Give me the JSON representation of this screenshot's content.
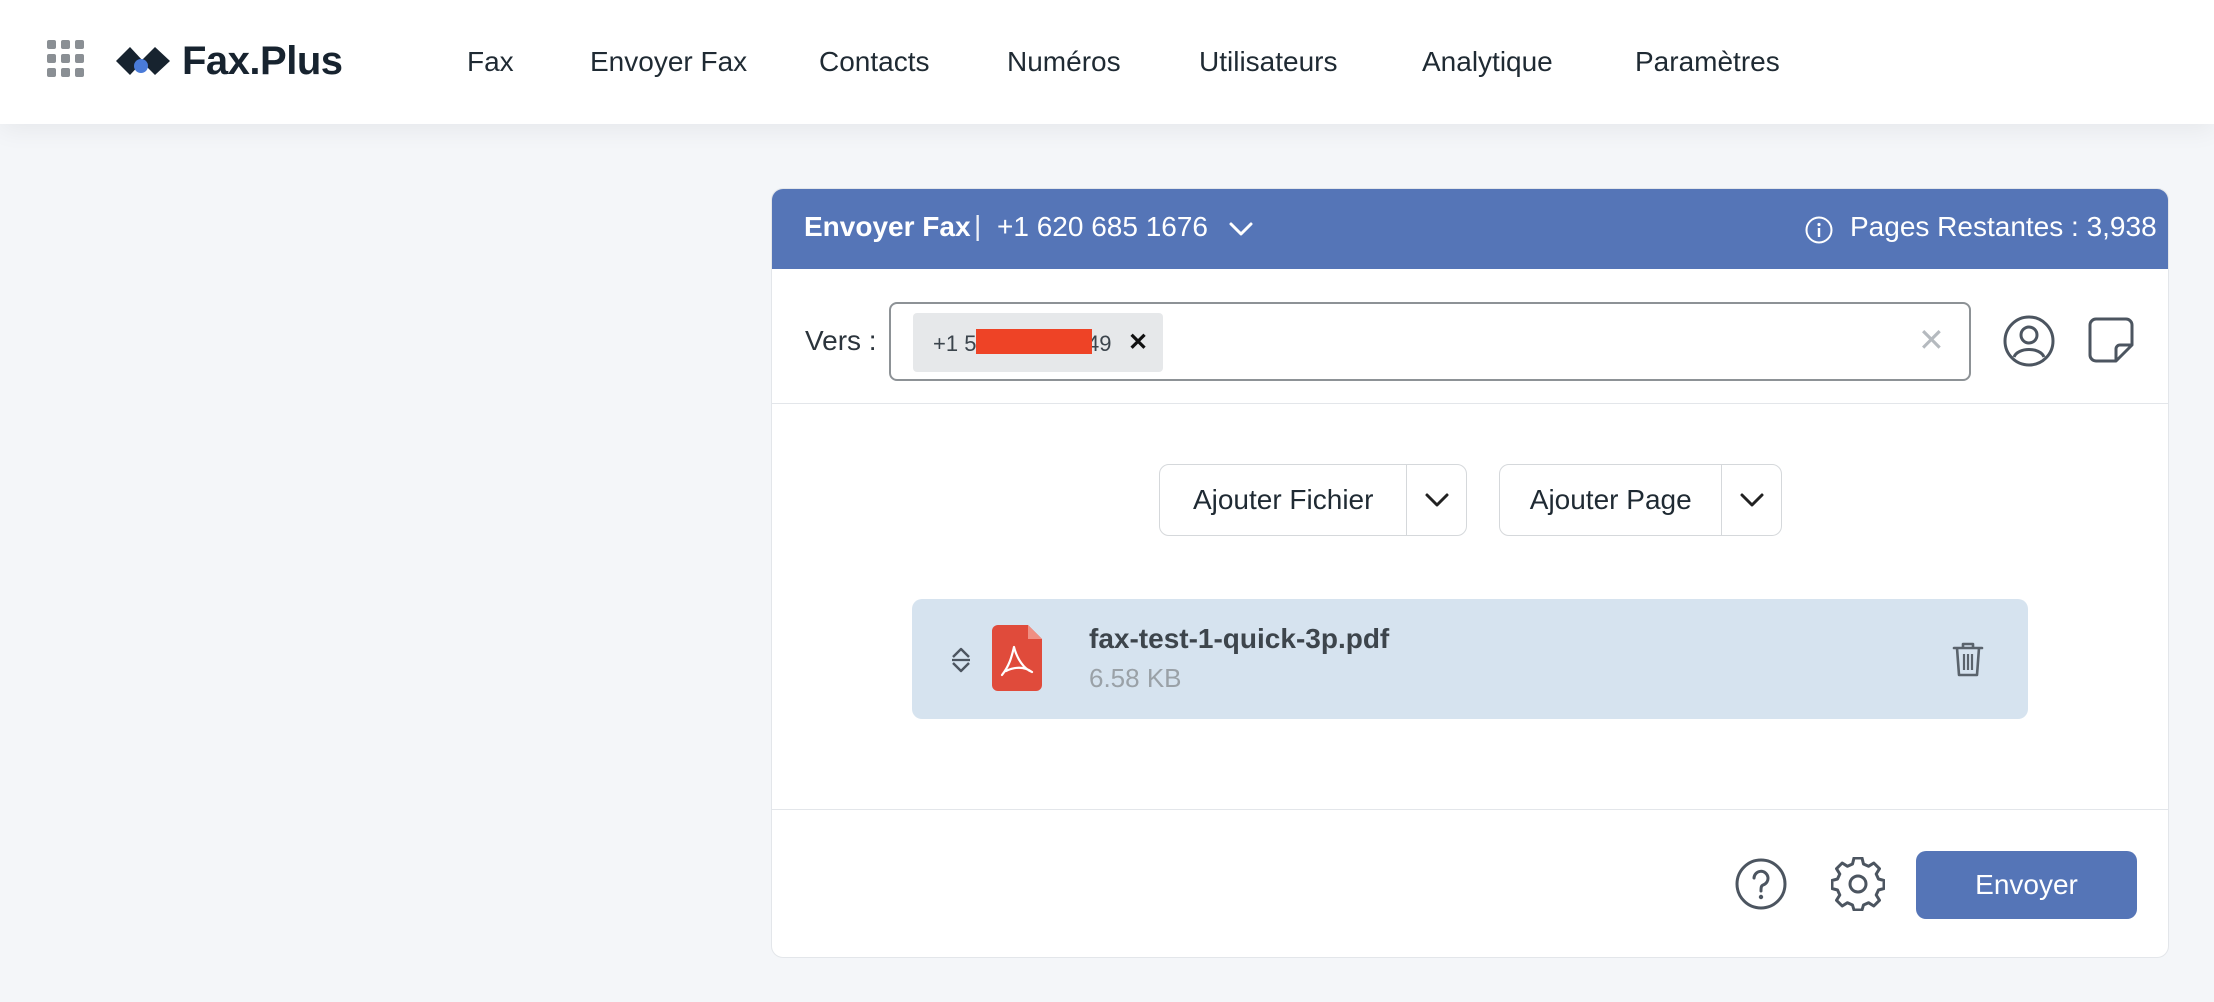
{
  "brand": {
    "logo_text": "Fax.Plus"
  },
  "nav": {
    "items": [
      {
        "label": "Fax"
      },
      {
        "label": "Envoyer Fax"
      },
      {
        "label": "Contacts"
      },
      {
        "label": "Numéros"
      },
      {
        "label": "Utilisateurs"
      },
      {
        "label": "Analytique"
      },
      {
        "label": "Paramètres"
      }
    ]
  },
  "send_fax": {
    "title": "Envoyer Fax",
    "separator": "|",
    "from_number": "+1 620 685 1676",
    "pages_remaining": "Pages Restantes : 3,938",
    "to_label": "Vers :",
    "recipient_prefix": "+1 5",
    "recipient_suffix": "49",
    "add_file_label": "Ajouter Fichier",
    "add_page_label": "Ajouter Page",
    "file": {
      "name": "fax-test-1-quick-3p.pdf",
      "size": "6.58 KB"
    },
    "send_label": "Envoyer"
  },
  "colors": {
    "accent": "#5575b7",
    "file_bg": "#d6e3ef",
    "pdf_red": "#e04b3b",
    "redaction": "#ee4326"
  }
}
